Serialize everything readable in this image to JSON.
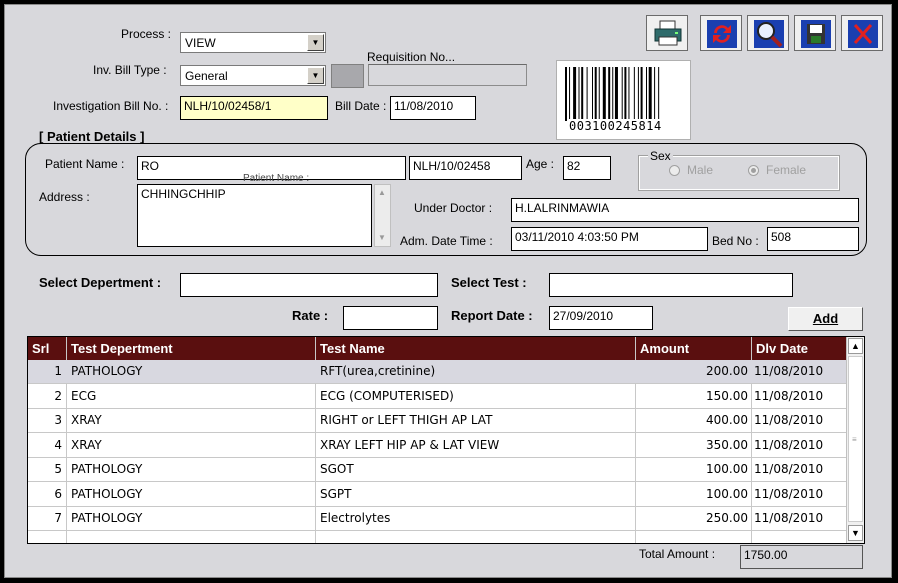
{
  "labels": {
    "process": "Process :",
    "inv_bill_type": "Inv. Bill Type :",
    "requisition_no": "Requisition No...",
    "investigation_bill_no": "Investigation Bill No. :",
    "bill_date": "Bill Date :",
    "patient_details": "[ Patient Details ]",
    "patient_name": "Patient Name :",
    "age": "Age :",
    "sex": "Sex",
    "male": "Male",
    "female": "Female",
    "address": "Address :",
    "under_doctor": "Under Doctor :",
    "adm_date_time": "Adm. Date Time :",
    "bed_no": "Bed No :",
    "select_department": "Select Depertment :",
    "select_test": "Select Test :",
    "rate": "Rate :",
    "report_date": "Report Date :",
    "add": "Add",
    "total_amount": "Total Amount :",
    "hidden_overlap": "Patient Name :"
  },
  "fields": {
    "process": "VIEW",
    "inv_bill_type": "General",
    "requisition_no": "",
    "investigation_bill_no": "NLH/10/02458/1",
    "bill_date": "11/08/2010",
    "patient_name": "RO",
    "patient_id": "NLH/10/02458",
    "age": "82",
    "sex_selected": "Female",
    "address": "CHHINGCHHIP",
    "under_doctor": "H.LALRINMAWIA",
    "adm_date_time": "03/11/2010 4:03:50 PM",
    "bed_no": "508",
    "select_department": "",
    "select_test": "",
    "rate": "",
    "report_date": "27/09/2010",
    "total_amount": "1750.00"
  },
  "barcode": {
    "number": "003100245814"
  },
  "toolbar": [
    "printer-icon",
    "refresh-icon",
    "search-icon",
    "save-icon",
    "close-icon"
  ],
  "grid": {
    "columns": [
      "Srl",
      "Test Depertment",
      "Test Name",
      "Amount",
      "Dlv Date"
    ],
    "rows": [
      {
        "srl": "1",
        "dept": "PATHOLOGY",
        "test": "RFT(urea,cretinine)",
        "amount": "200.00",
        "date": "11/08/2010"
      },
      {
        "srl": "2",
        "dept": "ECG",
        "test": "ECG (COMPUTERISED)",
        "amount": "150.00",
        "date": "11/08/2010"
      },
      {
        "srl": "3",
        "dept": "XRAY",
        "test": "RIGHT or LEFT THIGH AP LAT",
        "amount": "400.00",
        "date": "11/08/2010"
      },
      {
        "srl": "4",
        "dept": "XRAY",
        "test": "XRAY LEFT HIP AP & LAT VIEW",
        "amount": "350.00",
        "date": "11/08/2010"
      },
      {
        "srl": "5",
        "dept": "PATHOLOGY",
        "test": "SGOT",
        "amount": "100.00",
        "date": "11/08/2010"
      },
      {
        "srl": "6",
        "dept": "PATHOLOGY",
        "test": "SGPT",
        "amount": "100.00",
        "date": "11/08/2010"
      },
      {
        "srl": "7",
        "dept": "PATHOLOGY",
        "test": "Electrolytes",
        "amount": "250.00",
        "date": "11/08/2010"
      }
    ]
  },
  "colors": {
    "grid_header": "#5a0f0f",
    "highlight_field": "#ffffc8",
    "form_bg": "#d8d8dc"
  }
}
